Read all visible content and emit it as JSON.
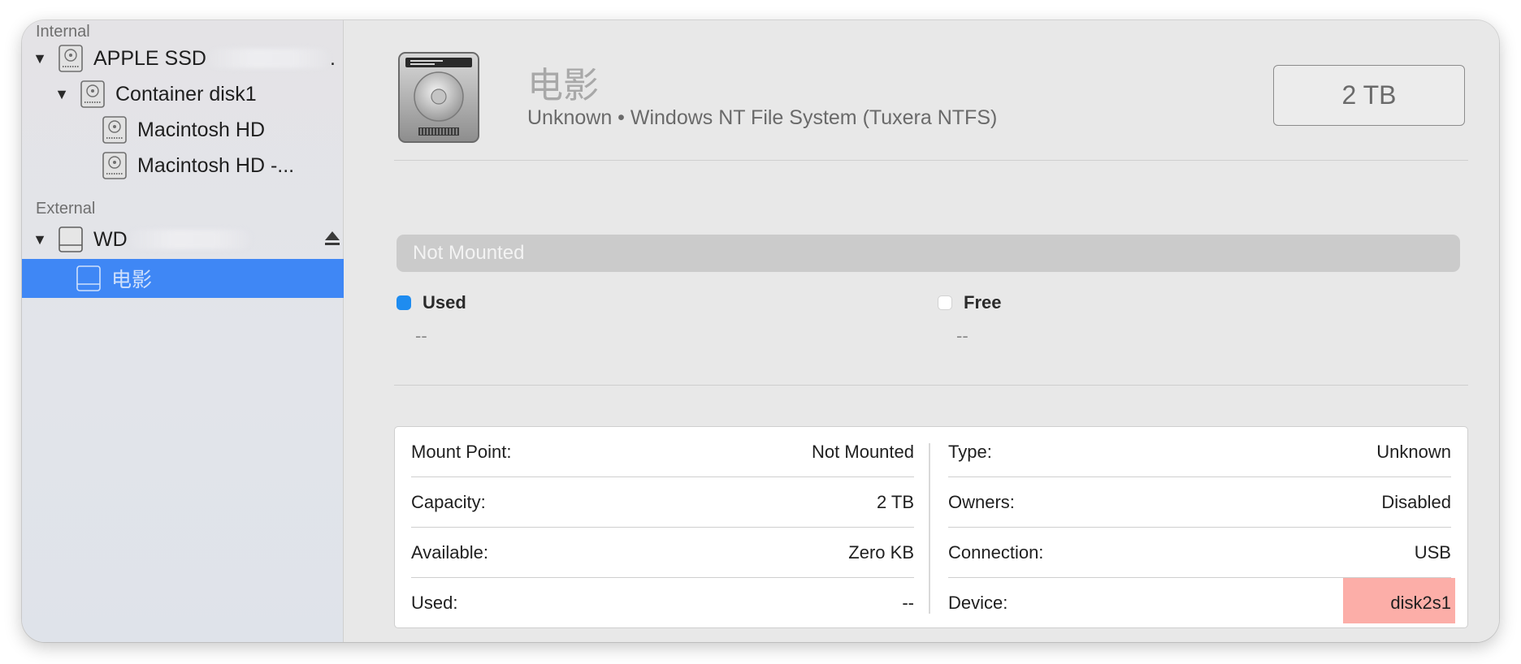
{
  "sidebar": {
    "sections": [
      {
        "header": "Internal"
      },
      {
        "header": "External"
      }
    ],
    "items": [
      {
        "label": "APPLE SSD",
        "suffix": "."
      },
      {
        "label": "Container disk1"
      },
      {
        "label": "Macintosh HD"
      },
      {
        "label": "Macintosh HD -..."
      },
      {
        "label": "WD"
      },
      {
        "label": "电影"
      }
    ]
  },
  "volume": {
    "name": "电影",
    "description": "Unknown • Windows NT File System (Tuxera NTFS)",
    "size": "2 TB"
  },
  "usage": {
    "status": "Not Mounted",
    "used_label": "Used",
    "used_value": "--",
    "free_label": "Free",
    "free_value": "--"
  },
  "info": {
    "left": [
      {
        "label": "Mount Point:",
        "value": "Not Mounted"
      },
      {
        "label": "Capacity:",
        "value": "2 TB"
      },
      {
        "label": "Available:",
        "value": "Zero KB"
      },
      {
        "label": "Used:",
        "value": "--"
      }
    ],
    "right": [
      {
        "label": "Type:",
        "value": "Unknown"
      },
      {
        "label": "Owners:",
        "value": "Disabled"
      },
      {
        "label": "Connection:",
        "value": "USB"
      },
      {
        "label": "Device:",
        "value": "disk2s1"
      }
    ]
  },
  "colors": {
    "selection": "#3f87f5",
    "used_swatch": "#1e8cf0",
    "free_swatch": "#ffffff",
    "highlight": "#f87a6e"
  },
  "icons": [
    "disclosure-triangle-icon",
    "internal-disk-icon",
    "external-disk-icon",
    "eject-icon",
    "hard-drive-icon"
  ]
}
